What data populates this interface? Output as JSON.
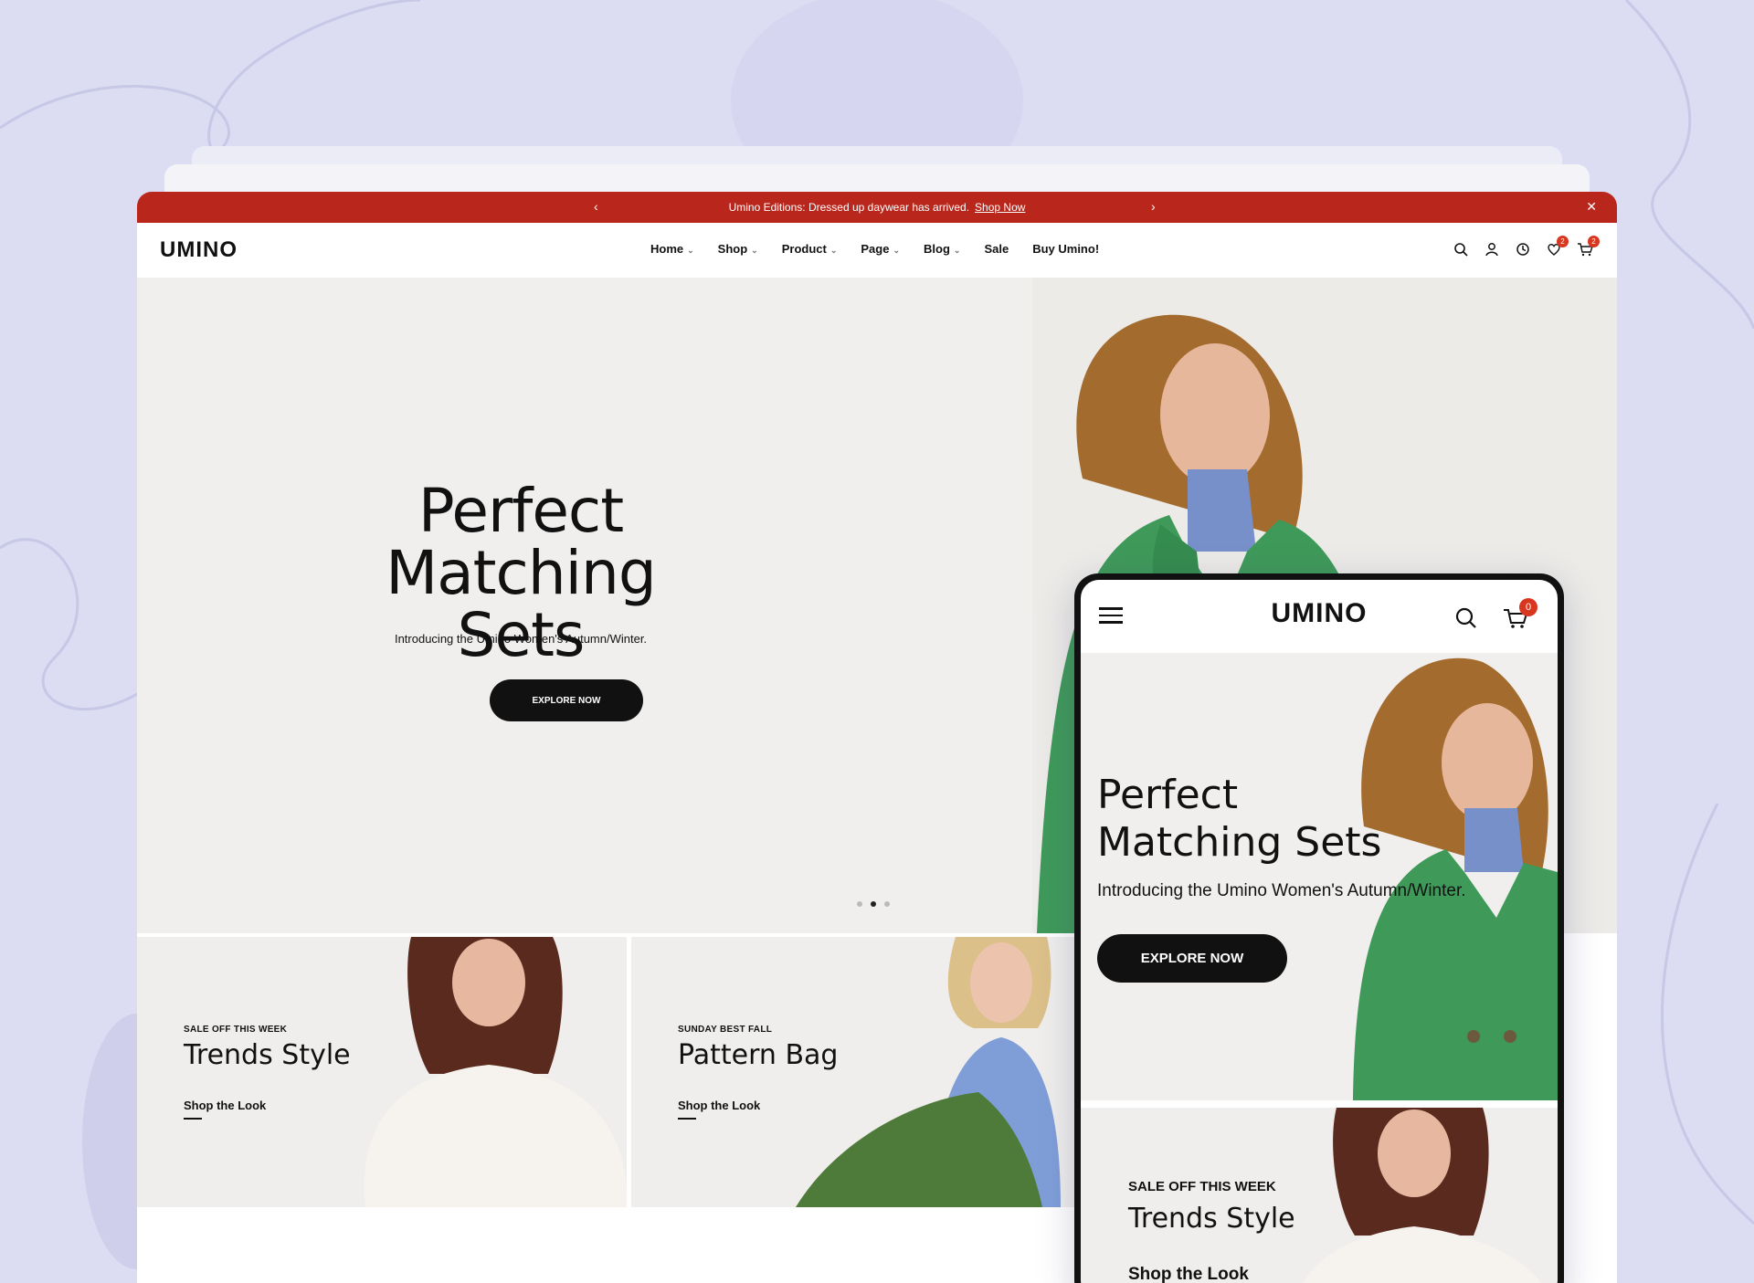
{
  "announcement": {
    "text": "Umino Editions: Dressed up daywear has arrived.",
    "link": "Shop Now"
  },
  "brand": "UMINO",
  "nav": [
    {
      "label": "Home",
      "dropdown": true
    },
    {
      "label": "Shop",
      "dropdown": true
    },
    {
      "label": "Product",
      "dropdown": true
    },
    {
      "label": "Page",
      "dropdown": true
    },
    {
      "label": "Blog",
      "dropdown": true
    },
    {
      "label": "Sale",
      "dropdown": false
    },
    {
      "label": "Buy Umino!",
      "dropdown": false
    }
  ],
  "header_icons": [
    {
      "name": "search-icon"
    },
    {
      "name": "account-icon"
    },
    {
      "name": "recent-icon"
    },
    {
      "name": "wishlist-icon",
      "badge": "2"
    },
    {
      "name": "cart-icon",
      "badge": "2"
    }
  ],
  "hero": {
    "title_line1": "Perfect",
    "title_line2": "Matching Sets",
    "subtitle": "Introducing the Umino Women's Autumn/Winter.",
    "cta": "EXPLORE NOW",
    "slide_current": 2,
    "slide_total": 3
  },
  "promos": [
    {
      "eyebrow": "SALE OFF THIS WEEK",
      "title": "Trends Style",
      "link": "Shop the Look"
    },
    {
      "eyebrow": "SUNDAY BEST FALL",
      "title": "Pattern Bag",
      "link": "Shop the Look"
    }
  ],
  "mobile": {
    "brand": "UMINO",
    "cart_count": "0",
    "hero": {
      "title_line1": "Perfect",
      "title_line2": "Matching Sets",
      "subtitle": "Introducing the Umino Women's Autumn/Winter.",
      "cta": "EXPLORE NOW"
    },
    "promo": {
      "eyebrow": "SALE OFF THIS WEEK",
      "title": "Trends Style",
      "link": "Shop the Look"
    }
  },
  "colors": {
    "background": "#dcdcf3",
    "announcement_bar": "#b9261c",
    "button": "#111111",
    "badge": "#d8361e",
    "jacket": "#3f9a5a"
  }
}
